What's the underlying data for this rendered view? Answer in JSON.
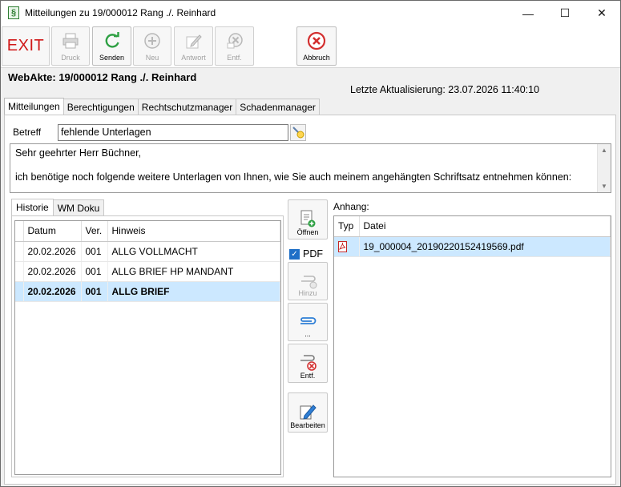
{
  "window": {
    "app_icon": "§",
    "title": "Mitteilungen zu 19/000012 Rang ./. Reinhard",
    "minimize": "—",
    "maximize": "☐",
    "close": "✕"
  },
  "toolbar": {
    "exit_label": "EXIT",
    "print_label": "Druck",
    "send_label": "Senden",
    "new_label": "Neu",
    "reply_label": "Antwort",
    "remove_label": "Entf.",
    "cancel_label": "Abbruch"
  },
  "header": {
    "webakte": "WebAkte: 19/000012 Rang ./. Reinhard",
    "last_update": "Letzte Aktualisierung:  23.07.2026 11:40:10"
  },
  "tabs": [
    "Mitteilungen",
    "Berechtigungen",
    "Rechtschutzmanager",
    "Schadenmanager"
  ],
  "betreff": {
    "label": "Betreff",
    "value": "fehlende Unterlagen"
  },
  "message": {
    "line1": "Sehr geehrter Herr Büchner,",
    "line2": "ich benötige noch folgende weitere Unterlagen von Ihnen, wie Sie auch meinem angehängten Schriftsatz entnehmen können:"
  },
  "subtabs": [
    "Historie",
    "WM Doku"
  ],
  "history": {
    "columns": [
      "Datum",
      "Ver.",
      "Hinweis"
    ],
    "rows": [
      {
        "datum": "20.02.2026",
        "ver": "001",
        "hinweis": "ALLG VOLLMACHT"
      },
      {
        "datum": "20.02.2026",
        "ver": "001",
        "hinweis": "ALLG BRIEF HP MANDANT"
      },
      {
        "datum": "20.02.2026",
        "ver": "001",
        "hinweis": "ALLG BRIEF"
      }
    ]
  },
  "side_buttons": {
    "open_label": "Öffnen",
    "pdf_label": "PDF",
    "add_label": "Hinzu",
    "attach_label": "...",
    "remove_label": "Entf.",
    "edit_label": "Bearbeiten"
  },
  "attachments": {
    "label": "Anhang:",
    "columns": [
      "Typ",
      "Datei"
    ],
    "rows": [
      {
        "typ": "PDF",
        "datei": "19_000004_20190220152419569.pdf"
      }
    ]
  },
  "colors": {
    "selection": "#cce8ff",
    "exit_red": "#d01818",
    "send_green": "#2ea043",
    "cancel_red": "#d32f2f"
  }
}
